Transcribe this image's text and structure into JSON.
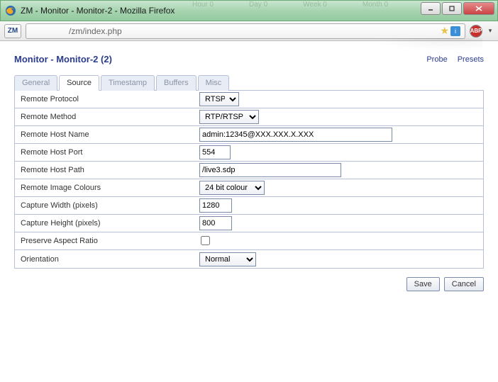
{
  "window": {
    "title": "ZM - Monitor - Monitor-2 - Mozilla Firefox",
    "faded": [
      "Hour 0",
      "Day 0",
      "Week 0",
      "Month 0"
    ]
  },
  "urlbar": {
    "identity": "ZM",
    "path": "/zm/index.php"
  },
  "header": {
    "title": "Monitor - Monitor-2 (2)",
    "links": {
      "probe": "Probe",
      "presets": "Presets"
    }
  },
  "tabs": {
    "general": "General",
    "source": "Source",
    "timestamp": "Timestamp",
    "buffers": "Buffers",
    "misc": "Misc",
    "active": "source"
  },
  "form": {
    "remote_protocol": {
      "label": "Remote Protocol",
      "value": "RTSP"
    },
    "remote_method": {
      "label": "Remote Method",
      "value": "RTP/RTSP"
    },
    "remote_host": {
      "label": "Remote Host Name",
      "value": "admin:12345@XXX.XXX.X.XXX"
    },
    "remote_port": {
      "label": "Remote Host Port",
      "value": "554"
    },
    "remote_path": {
      "label": "Remote Host Path",
      "value": "/live3.sdp"
    },
    "image_colours": {
      "label": "Remote Image Colours",
      "value": "24 bit colour"
    },
    "capture_width": {
      "label": "Capture Width (pixels)",
      "value": "1280"
    },
    "capture_height": {
      "label": "Capture Height (pixels)",
      "value": "800"
    },
    "preserve_aspect": {
      "label": "Preserve Aspect Ratio",
      "checked": false
    },
    "orientation": {
      "label": "Orientation",
      "value": "Normal"
    }
  },
  "buttons": {
    "save": "Save",
    "cancel": "Cancel"
  }
}
